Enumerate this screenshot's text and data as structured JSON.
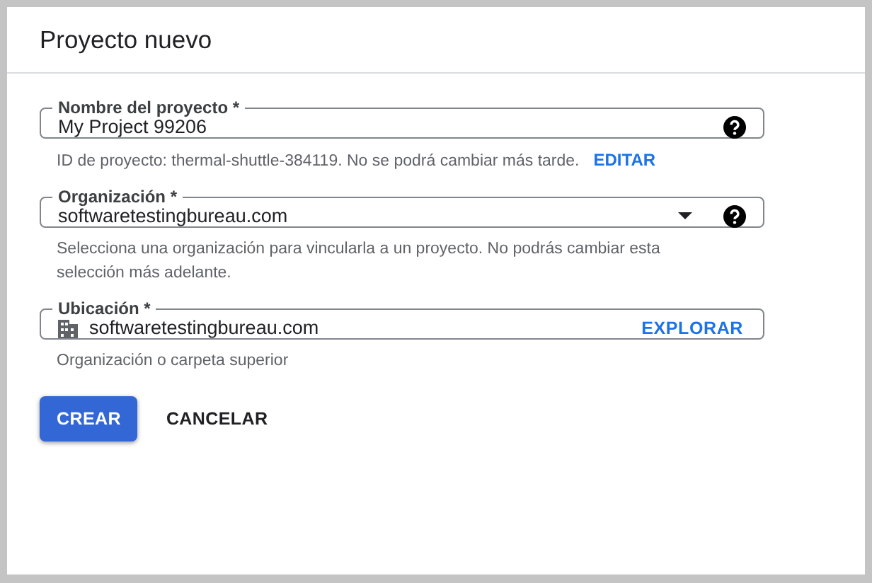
{
  "dialog": {
    "title": "Proyecto nuevo"
  },
  "fields": [
    {
      "kind": "text",
      "label": "Nombre del proyecto *",
      "value": "My Project 99206",
      "help": true,
      "hint": "ID de proyecto: thermal-shuttle-384119. No se podrá cambiar más tarde.",
      "hint_link": "EDITAR"
    },
    {
      "kind": "select",
      "label": "Organización *",
      "value": "softwaretestingbureau.com",
      "help": true,
      "hint": "Selecciona una organización para vincularla a un proyecto. No podrás cambiar esta selección más adelante."
    },
    {
      "kind": "location",
      "label": "Ubicación *",
      "value": "softwaretestingbureau.com",
      "action": "EXPLORAR",
      "hint": "Organización o carpeta superior"
    }
  ],
  "buttons": [
    {
      "label": "CREAR",
      "kind": "primary"
    },
    {
      "label": "CANCELAR",
      "kind": "text"
    }
  ]
}
